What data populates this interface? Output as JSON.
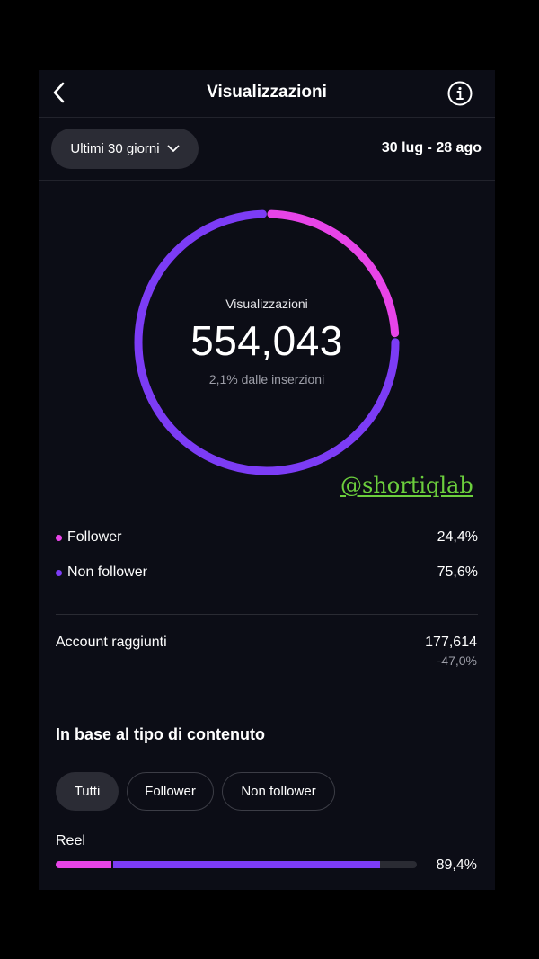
{
  "header": {
    "title": "Visualizzazioni"
  },
  "filter": {
    "range_label": "Ultimi 30 giorni",
    "date_range": "30 lug - 28 ago"
  },
  "summary": {
    "label": "Visualizzazioni",
    "total": "554,043",
    "subtitle": "2,1% dalle inserzioni",
    "follower_fraction": 0.244
  },
  "breakdown": [
    {
      "label": "Follower",
      "percent": "24,4%",
      "color": "#e844e8"
    },
    {
      "label": "Non follower",
      "percent": "75,6%",
      "color": "#7c3cf5"
    }
  ],
  "reach": {
    "label": "Account raggiunti",
    "value": "177,614",
    "change": "-47,0%"
  },
  "content_type": {
    "title": "In base al tipo di contenuto",
    "tabs": [
      "Tutti",
      "Follower",
      "Non follower"
    ],
    "active_tab": "Tutti",
    "rows": [
      {
        "label": "Reel",
        "percent": "89,4%",
        "total_fraction": 0.894,
        "follower_fraction": 0.155
      }
    ]
  },
  "watermark": "@shortiqlab",
  "colors": {
    "follower": "#e844e8",
    "non_follower": "#7c3cf5",
    "background": "#0c0d16"
  }
}
